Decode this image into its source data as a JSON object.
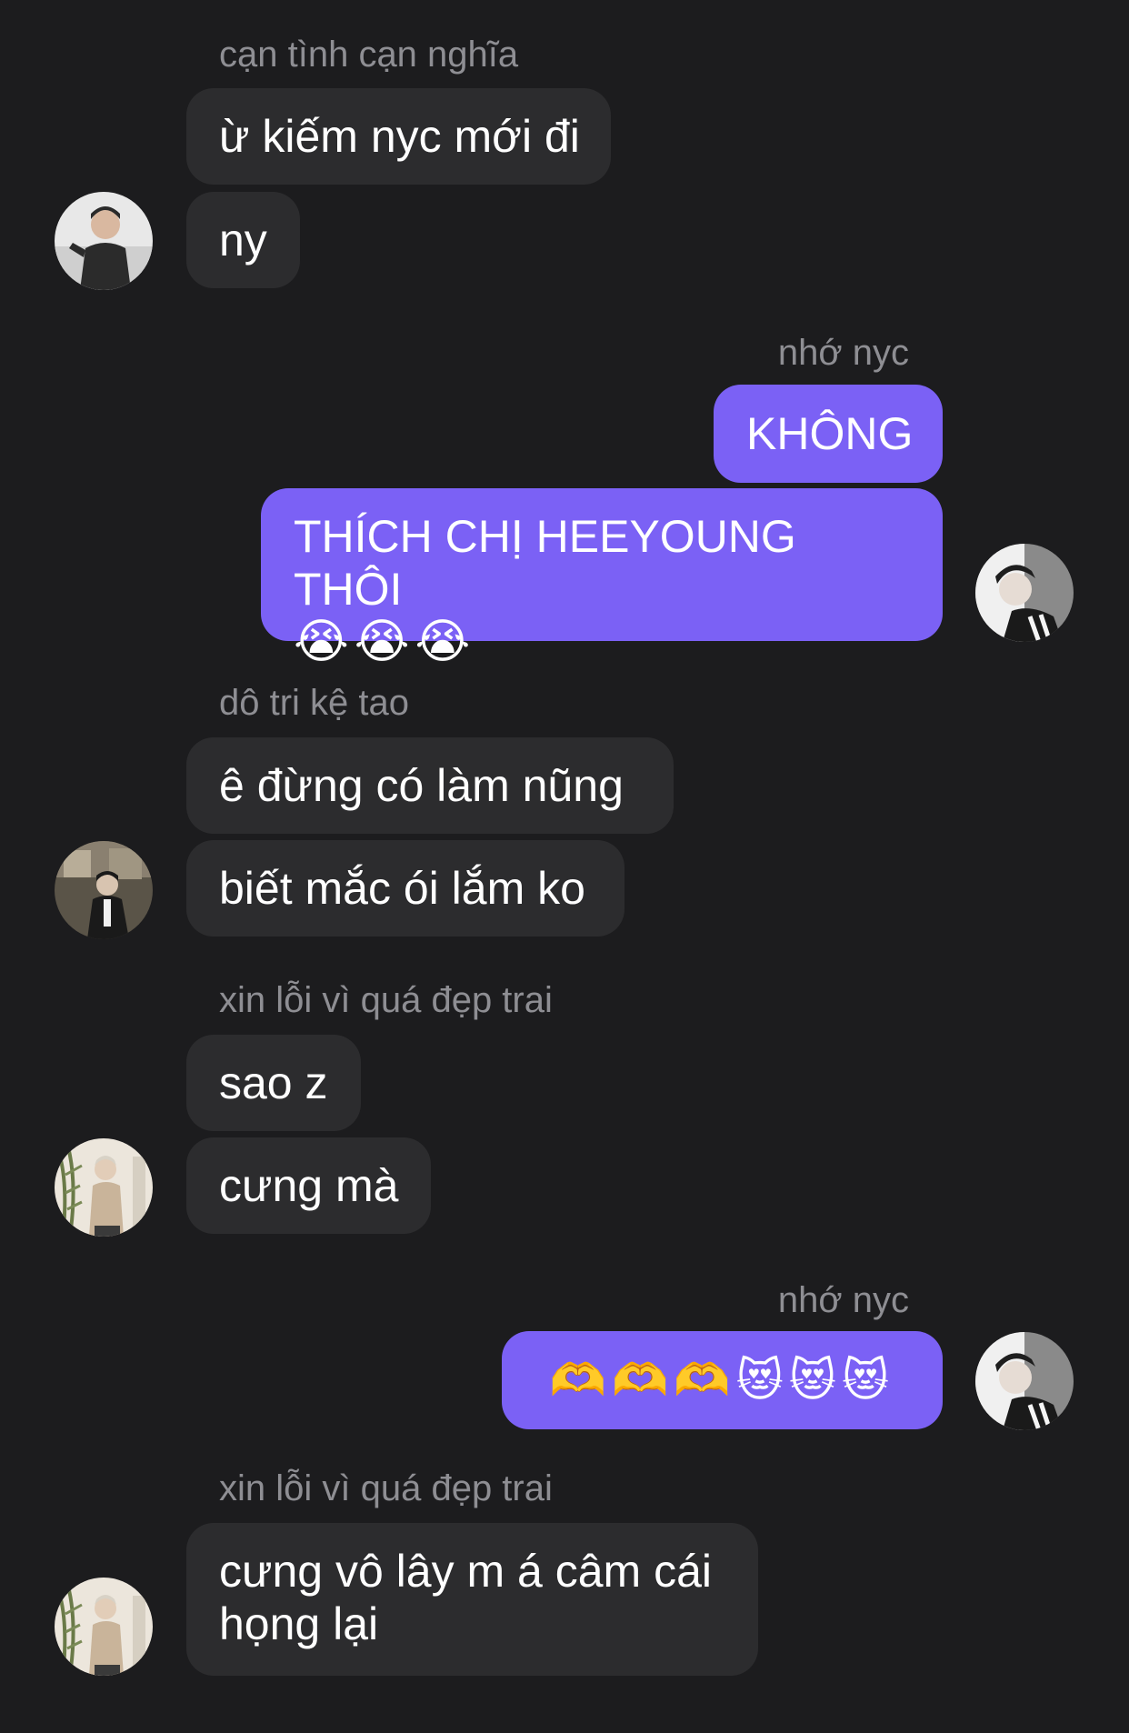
{
  "groups": [
    {
      "sender": "cạn tình cạn nghĩa",
      "messages": [
        "ừ kiếm nyc mới đi",
        "ny"
      ]
    },
    {
      "sender": "nhớ nyc",
      "messages": [
        "KHÔNG",
        "THÍCH CHỊ HEEYOUNG THÔI",
        "😭😭😭"
      ]
    },
    {
      "sender": "dô tri kệ tao",
      "messages": [
        "ê đừng có làm nũng",
        "biết mắc ói lắm ko"
      ]
    },
    {
      "sender": "xin lỗi vì quá đẹp trai",
      "messages": [
        "sao z",
        "cưng mà"
      ]
    },
    {
      "sender": "nhớ nyc",
      "messages": [
        "🫶🫶🫶😻😻😻"
      ]
    },
    {
      "sender": "xin lỗi vì quá đẹp trai",
      "messages": [
        "cưng vô lây m á câm cái họng lại"
      ]
    }
  ],
  "colors": {
    "background": "#1c1c1e",
    "incoming_bubble": "#2c2c2e",
    "outgoing_bubble": "#7b61f5",
    "sender_name": "#8e8e93"
  },
  "icons": [
    "avatar-cantinh",
    "avatar-me",
    "avatar-dotri",
    "avatar-xinloi"
  ]
}
